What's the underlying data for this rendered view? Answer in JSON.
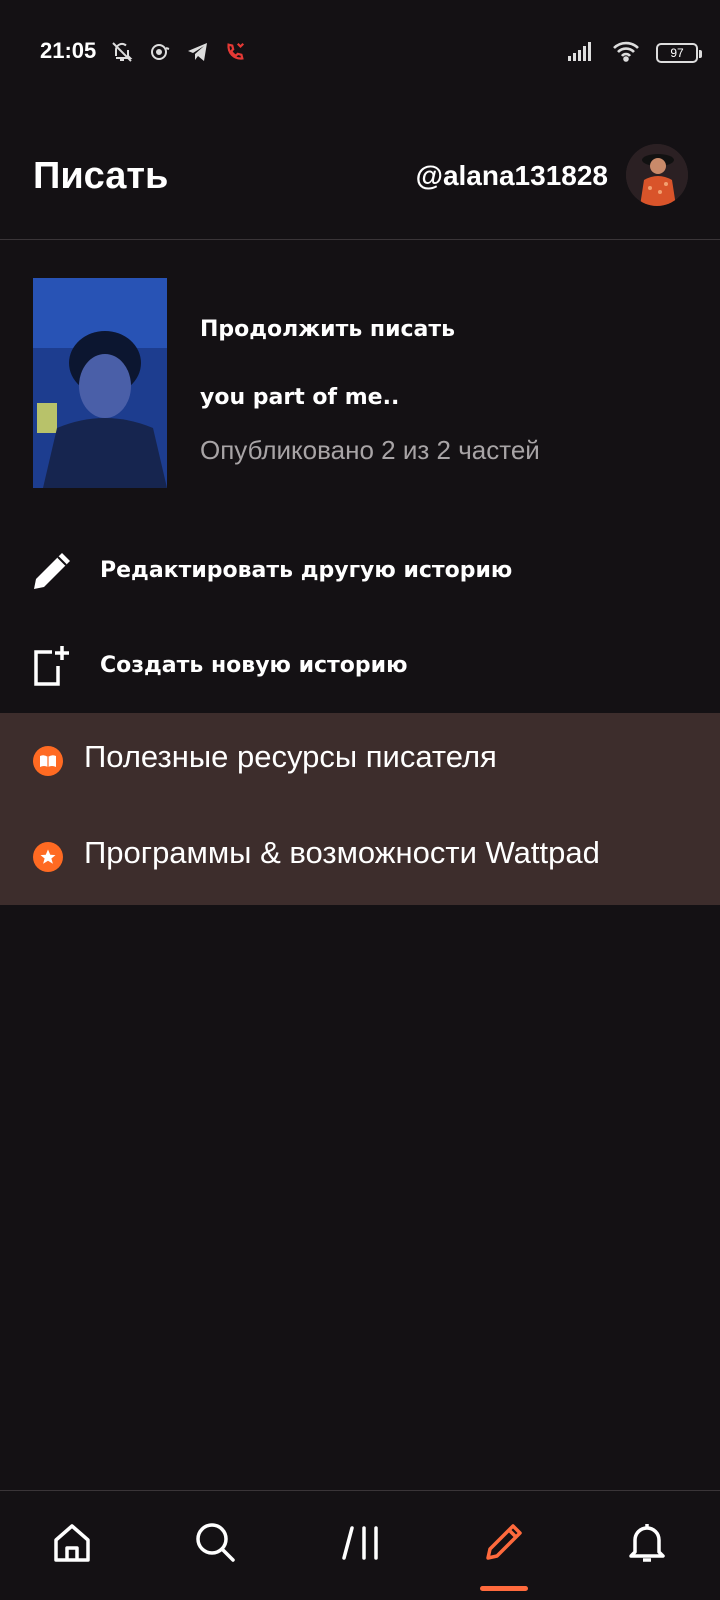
{
  "status_bar": {
    "time": "21:05",
    "battery": "97",
    "left_icons": [
      "bell-off-icon",
      "sync-icon",
      "telegram-icon",
      "missed-call-icon"
    ],
    "right_icons": [
      "signal-icon",
      "wifi-icon",
      "battery-icon"
    ]
  },
  "header": {
    "title": "Писать",
    "username": "@alana131828"
  },
  "continue_writing": {
    "label": "Продолжить писать",
    "story_title": "you part of me..",
    "meta": "Опубликовано 2 из 2 частей"
  },
  "actions": [
    {
      "label": "Редактировать другую историю",
      "icon": "pencil-icon"
    },
    {
      "label": "Создать новую историю",
      "icon": "new-story-icon"
    }
  ],
  "resources": [
    {
      "label": "Полезные ресурсы писателя",
      "icon": "book-icon"
    },
    {
      "label": "Программы & возможности Wattpad",
      "icon": "star-icon"
    }
  ],
  "bottom_nav": [
    {
      "name": "home",
      "icon": "home-icon"
    },
    {
      "name": "search",
      "icon": "search-icon"
    },
    {
      "name": "library",
      "icon": "library-icon"
    },
    {
      "name": "write",
      "icon": "pencil-icon",
      "active": true
    },
    {
      "name": "notifications",
      "icon": "bell-icon"
    }
  ],
  "colors": {
    "background": "#141114",
    "accent": "#ff6a22",
    "resources_bg": "#3d2d2c"
  }
}
